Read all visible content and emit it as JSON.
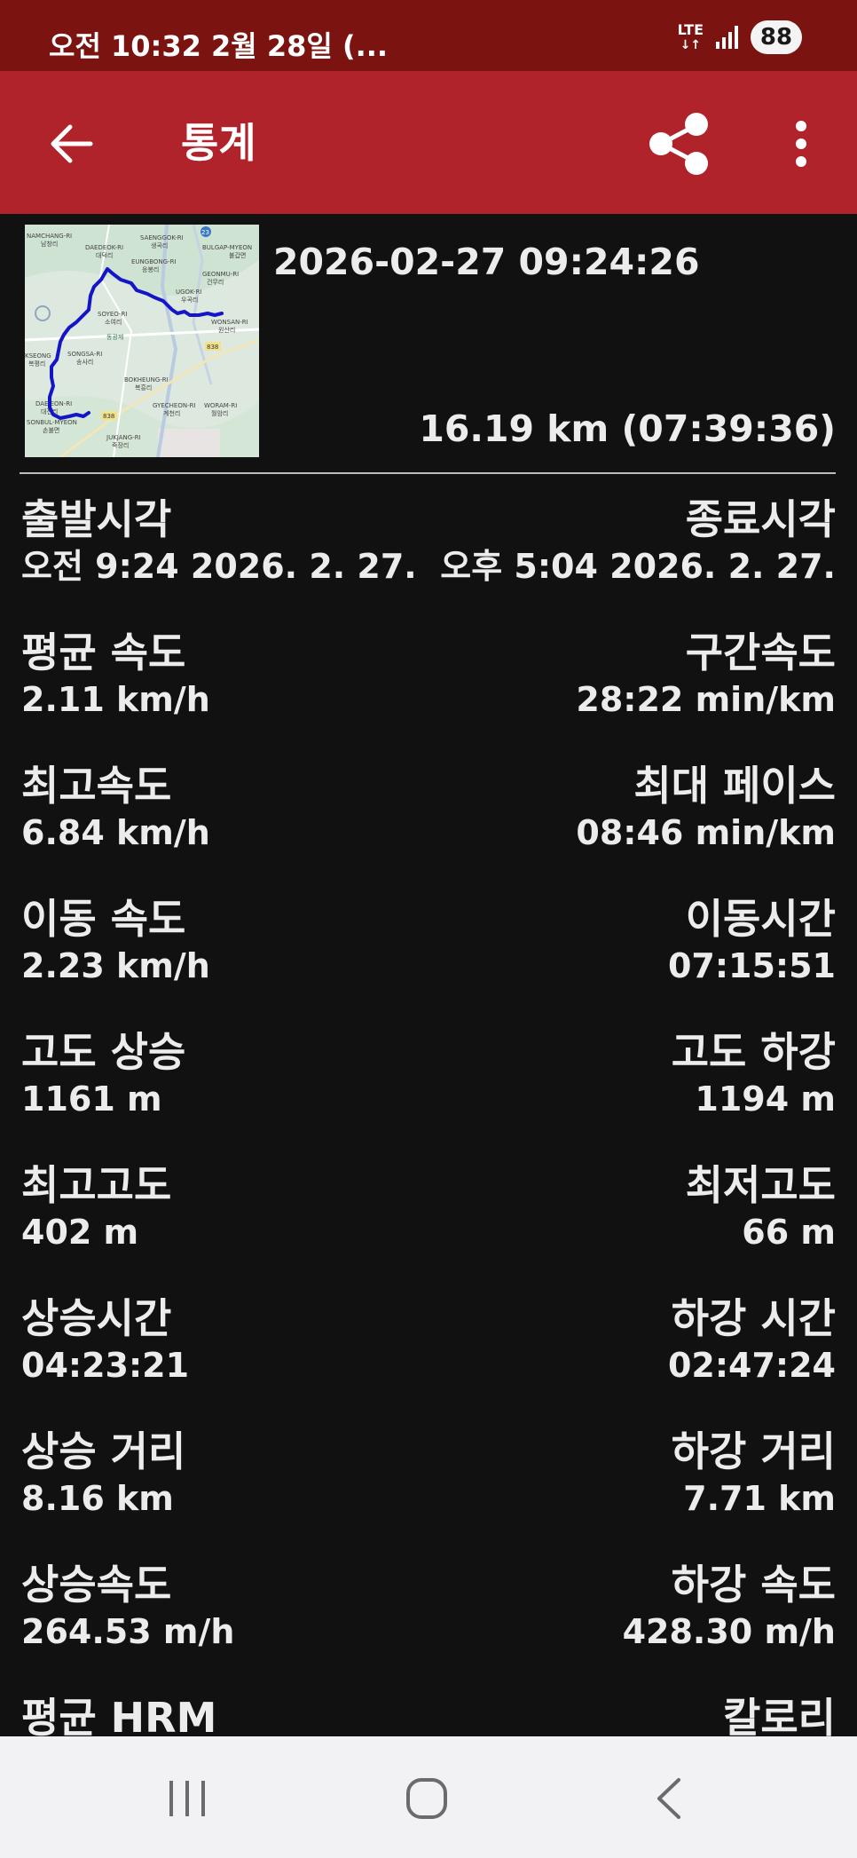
{
  "status_bar": {
    "time_date": "오전 10:32  2월 28일 (...",
    "network": "LTE",
    "battery": "88"
  },
  "app_bar": {
    "title": "통계"
  },
  "summary": {
    "date_time": "2026-02-27 09:24:26",
    "distance_duration": "16.19 km (07:39:36)"
  },
  "map": {
    "labels": [
      "NAMCHANG-RI",
      "남창리",
      "DAEDEOK-RI",
      "대덕리",
      "SAENGGOK-RI",
      "생곡리",
      "BULGAP-MYEON",
      "불갑면",
      "EUNGBONG-RI",
      "응봉리",
      "GEONMU-RI",
      "건무리",
      "UGOK-RI",
      "우곡리",
      "WONSAN-RI",
      "원산리",
      "SOYEO-RI",
      "소여리",
      "동광제",
      "SONGSA-RI",
      "송사리",
      "BOKHEUNG-RI",
      "복흥리",
      "GYECHEON-RI",
      "계천리",
      "WORAM-RI",
      "월암리",
      "DAEJEON-RI",
      "대전리",
      "SONBUL-MYEON",
      "손불면",
      "JUKJANG-RI",
      "죽장리",
      "KSEONG",
      "복평리",
      "838",
      "23"
    ],
    "route_color": "#1515c8"
  },
  "stats": [
    {
      "left_label": "출발시각",
      "left_value": "오전 9:24 2026. 2. 27.",
      "right_label": "종료시각",
      "right_value": "오후 5:04 2026. 2. 27."
    },
    {
      "left_label": "평균 속도",
      "left_value": "2.11 km/h",
      "right_label": "구간속도",
      "right_value": "28:22 min/km"
    },
    {
      "left_label": "최고속도",
      "left_value": "6.84 km/h",
      "right_label": "최대 페이스",
      "right_value": "08:46 min/km"
    },
    {
      "left_label": "이동 속도",
      "left_value": "2.23 km/h",
      "right_label": "이동시간",
      "right_value": "07:15:51"
    },
    {
      "left_label": "고도 상승",
      "left_value": "1161 m",
      "right_label": "고도 하강",
      "right_value": "1194 m"
    },
    {
      "left_label": "최고고도",
      "left_value": "402 m",
      "right_label": "최저고도",
      "right_value": "66 m"
    },
    {
      "left_label": "상승시간",
      "left_value": "04:23:21",
      "right_label": "하강 시간",
      "right_value": "02:47:24"
    },
    {
      "left_label": "상승 거리",
      "left_value": "8.16 km",
      "right_label": "하강 거리",
      "right_value": "7.71 km"
    },
    {
      "left_label": "상승속도",
      "left_value": "264.53 m/h",
      "right_label": "하강 속도",
      "right_value": "428.30 m/h"
    },
    {
      "left_label": "평균 HRM",
      "left_value": "",
      "right_label": "칼로리",
      "right_value": ""
    }
  ],
  "colors": {
    "status_bar": "#7b1410",
    "app_bar": "#b0232b",
    "background": "#111111",
    "text": "#ececec",
    "nav_bar": "#f2f2f4"
  }
}
